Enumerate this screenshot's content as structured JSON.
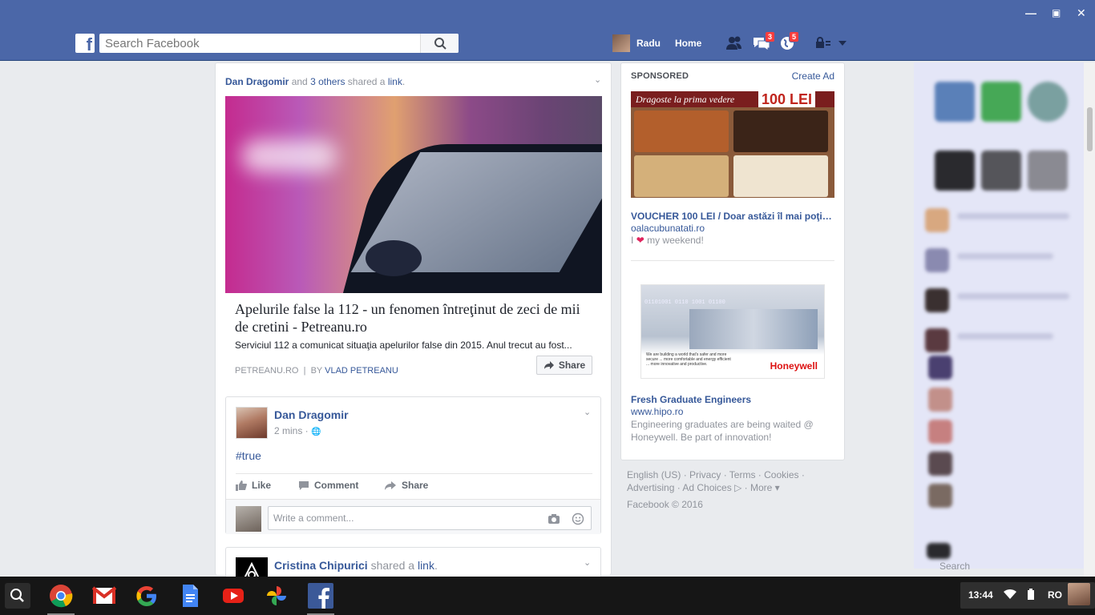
{
  "window": {
    "minimize_glyph": "—",
    "maximize_glyph": "▣",
    "close_glyph": "✕"
  },
  "header": {
    "logo": "f",
    "search_placeholder": "Search Facebook",
    "user_name": "Radu",
    "home_label": "Home",
    "messages_badge": "3",
    "notifications_badge": "5"
  },
  "shared_post": {
    "actor": "Dan Dragomir",
    "and_text": "and",
    "others": "3 others",
    "shared_text": "shared a",
    "link_word": "link",
    "period": ".",
    "title": "Apelurile false la 112 - un fenomen întreţinut de zeci de mii de cretini - Petreanu.ro",
    "description": "Serviciul 112 a comunicat situaţia apelurilor false din 2015. Anul trecut au fost...",
    "domain": "PETREANU.RO",
    "separator": "|",
    "by_label": "BY",
    "author": "VLAD PETREANU",
    "share_label": "Share"
  },
  "post": {
    "author": "Dan Dragomir",
    "time": "2 mins ·",
    "privacy_glyph": "🌐",
    "hashtag": "#true",
    "like_label": "Like",
    "comment_label": "Comment",
    "share_label": "Share",
    "comment_placeholder": "Write a comment..."
  },
  "post3": {
    "author": "Cristina Chipurici",
    "shared_text": "shared a",
    "link_word": "link",
    "period": "."
  },
  "ads": {
    "sponsored_label": "SPONSORED",
    "create_ad": "Create Ad",
    "ad1": {
      "banner_text": "Dragoste la prima vedere",
      "banner_amount": "100 LEI",
      "title": "VOUCHER 100 LEI / Doar astăzi îl mai poţi f...",
      "url": "oalacubunatati.ro",
      "desc_prefix": "I",
      "desc_suffix": "my weekend!"
    },
    "ad2": {
      "brand": "Honeywell",
      "bits": "01101001 0110 1001 01100",
      "tagline": "We are building a world that's safer and more secure ... more comfortable and energy efficient ... more innovative and productive.",
      "title": "Fresh Graduate Engineers",
      "url": "www.hipo.ro",
      "desc": "Engineering graduates are being waited @ Honeywell. Be part of innovation!"
    }
  },
  "footer": {
    "line1": "English (US) · Privacy · Terms · Cookies ·",
    "line2": "Advertising · Ad Choices ▷ · More ▾",
    "copyright": "Facebook © 2016"
  },
  "chat": {
    "search_placeholder": "Search"
  },
  "taskbar": {
    "clock": "13:44",
    "language": "RO",
    "apps": [
      "chrome-icon",
      "gmail-icon",
      "google-icon",
      "docs-icon",
      "youtube-icon",
      "photos-icon",
      "facebook-app-icon"
    ]
  },
  "colors": {
    "brand": "#4b67a8",
    "link": "#365899",
    "badge": "#fa3e3e"
  }
}
